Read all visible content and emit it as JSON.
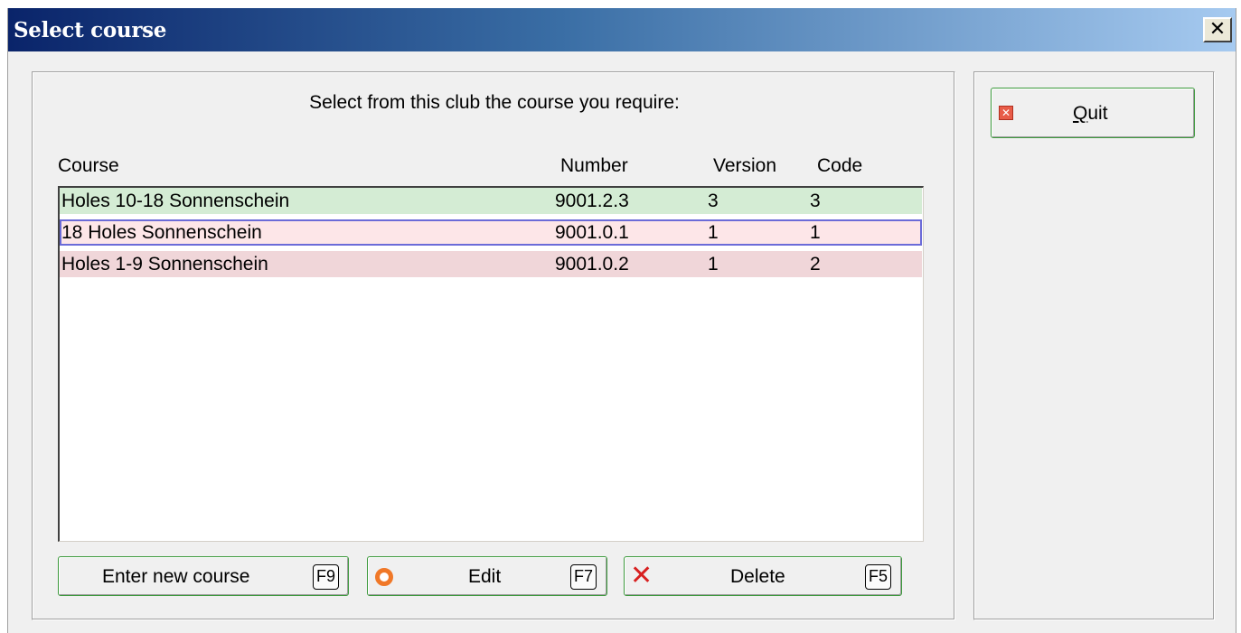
{
  "window": {
    "title": "Select course",
    "close_glyph": "✕"
  },
  "main": {
    "prompt": "Select from this club the course you require:",
    "columns": {
      "course": "Course",
      "number": "Number",
      "version": "Version",
      "code": "Code"
    },
    "rows": [
      {
        "course": "Holes 10-18 Sonnenschein",
        "number": "9001.2.3",
        "version": "3",
        "code": "3",
        "color": "#d4ecd4",
        "selected": false
      },
      {
        "course": "18 Holes Sonnenschein",
        "number": "9001.0.1",
        "version": "1",
        "code": "1",
        "color": "#fde6e8",
        "selected": true
      },
      {
        "course": "Holes 1-9 Sonnenschein",
        "number": "9001.0.2",
        "version": "1",
        "code": "2",
        "color": "#f0d6d9",
        "selected": false
      }
    ]
  },
  "buttons": {
    "enter_new": {
      "label": "Enter new course",
      "key": "F9"
    },
    "edit": {
      "label": "Edit",
      "key": "F7",
      "icon": "orange-ring-icon"
    },
    "delete": {
      "label": "Delete",
      "key": "F5",
      "icon": "red-x-icon"
    },
    "quit": {
      "label_first": "Q",
      "label_rest": "uit",
      "icon": "quit-icon"
    }
  },
  "colors": {
    "button_border": "#3d9a3d",
    "selection_outline": "#6b6bd8"
  }
}
